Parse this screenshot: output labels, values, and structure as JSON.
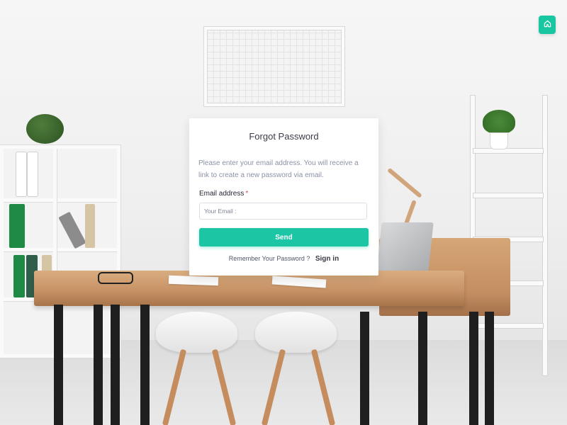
{
  "header": {
    "home_icon": "home-icon",
    "accent": "#18c6a1"
  },
  "card": {
    "title": "Forgot Password",
    "description": "Please enter your email address. You will receive a link to create a new password via email.",
    "email_label": "Email address",
    "required_mark": "*",
    "email_placeholder": "Your Email :",
    "email_value": "",
    "send_label": "Send",
    "remember_text": "Remember Your Password ?",
    "signin_label": "Sign in"
  }
}
